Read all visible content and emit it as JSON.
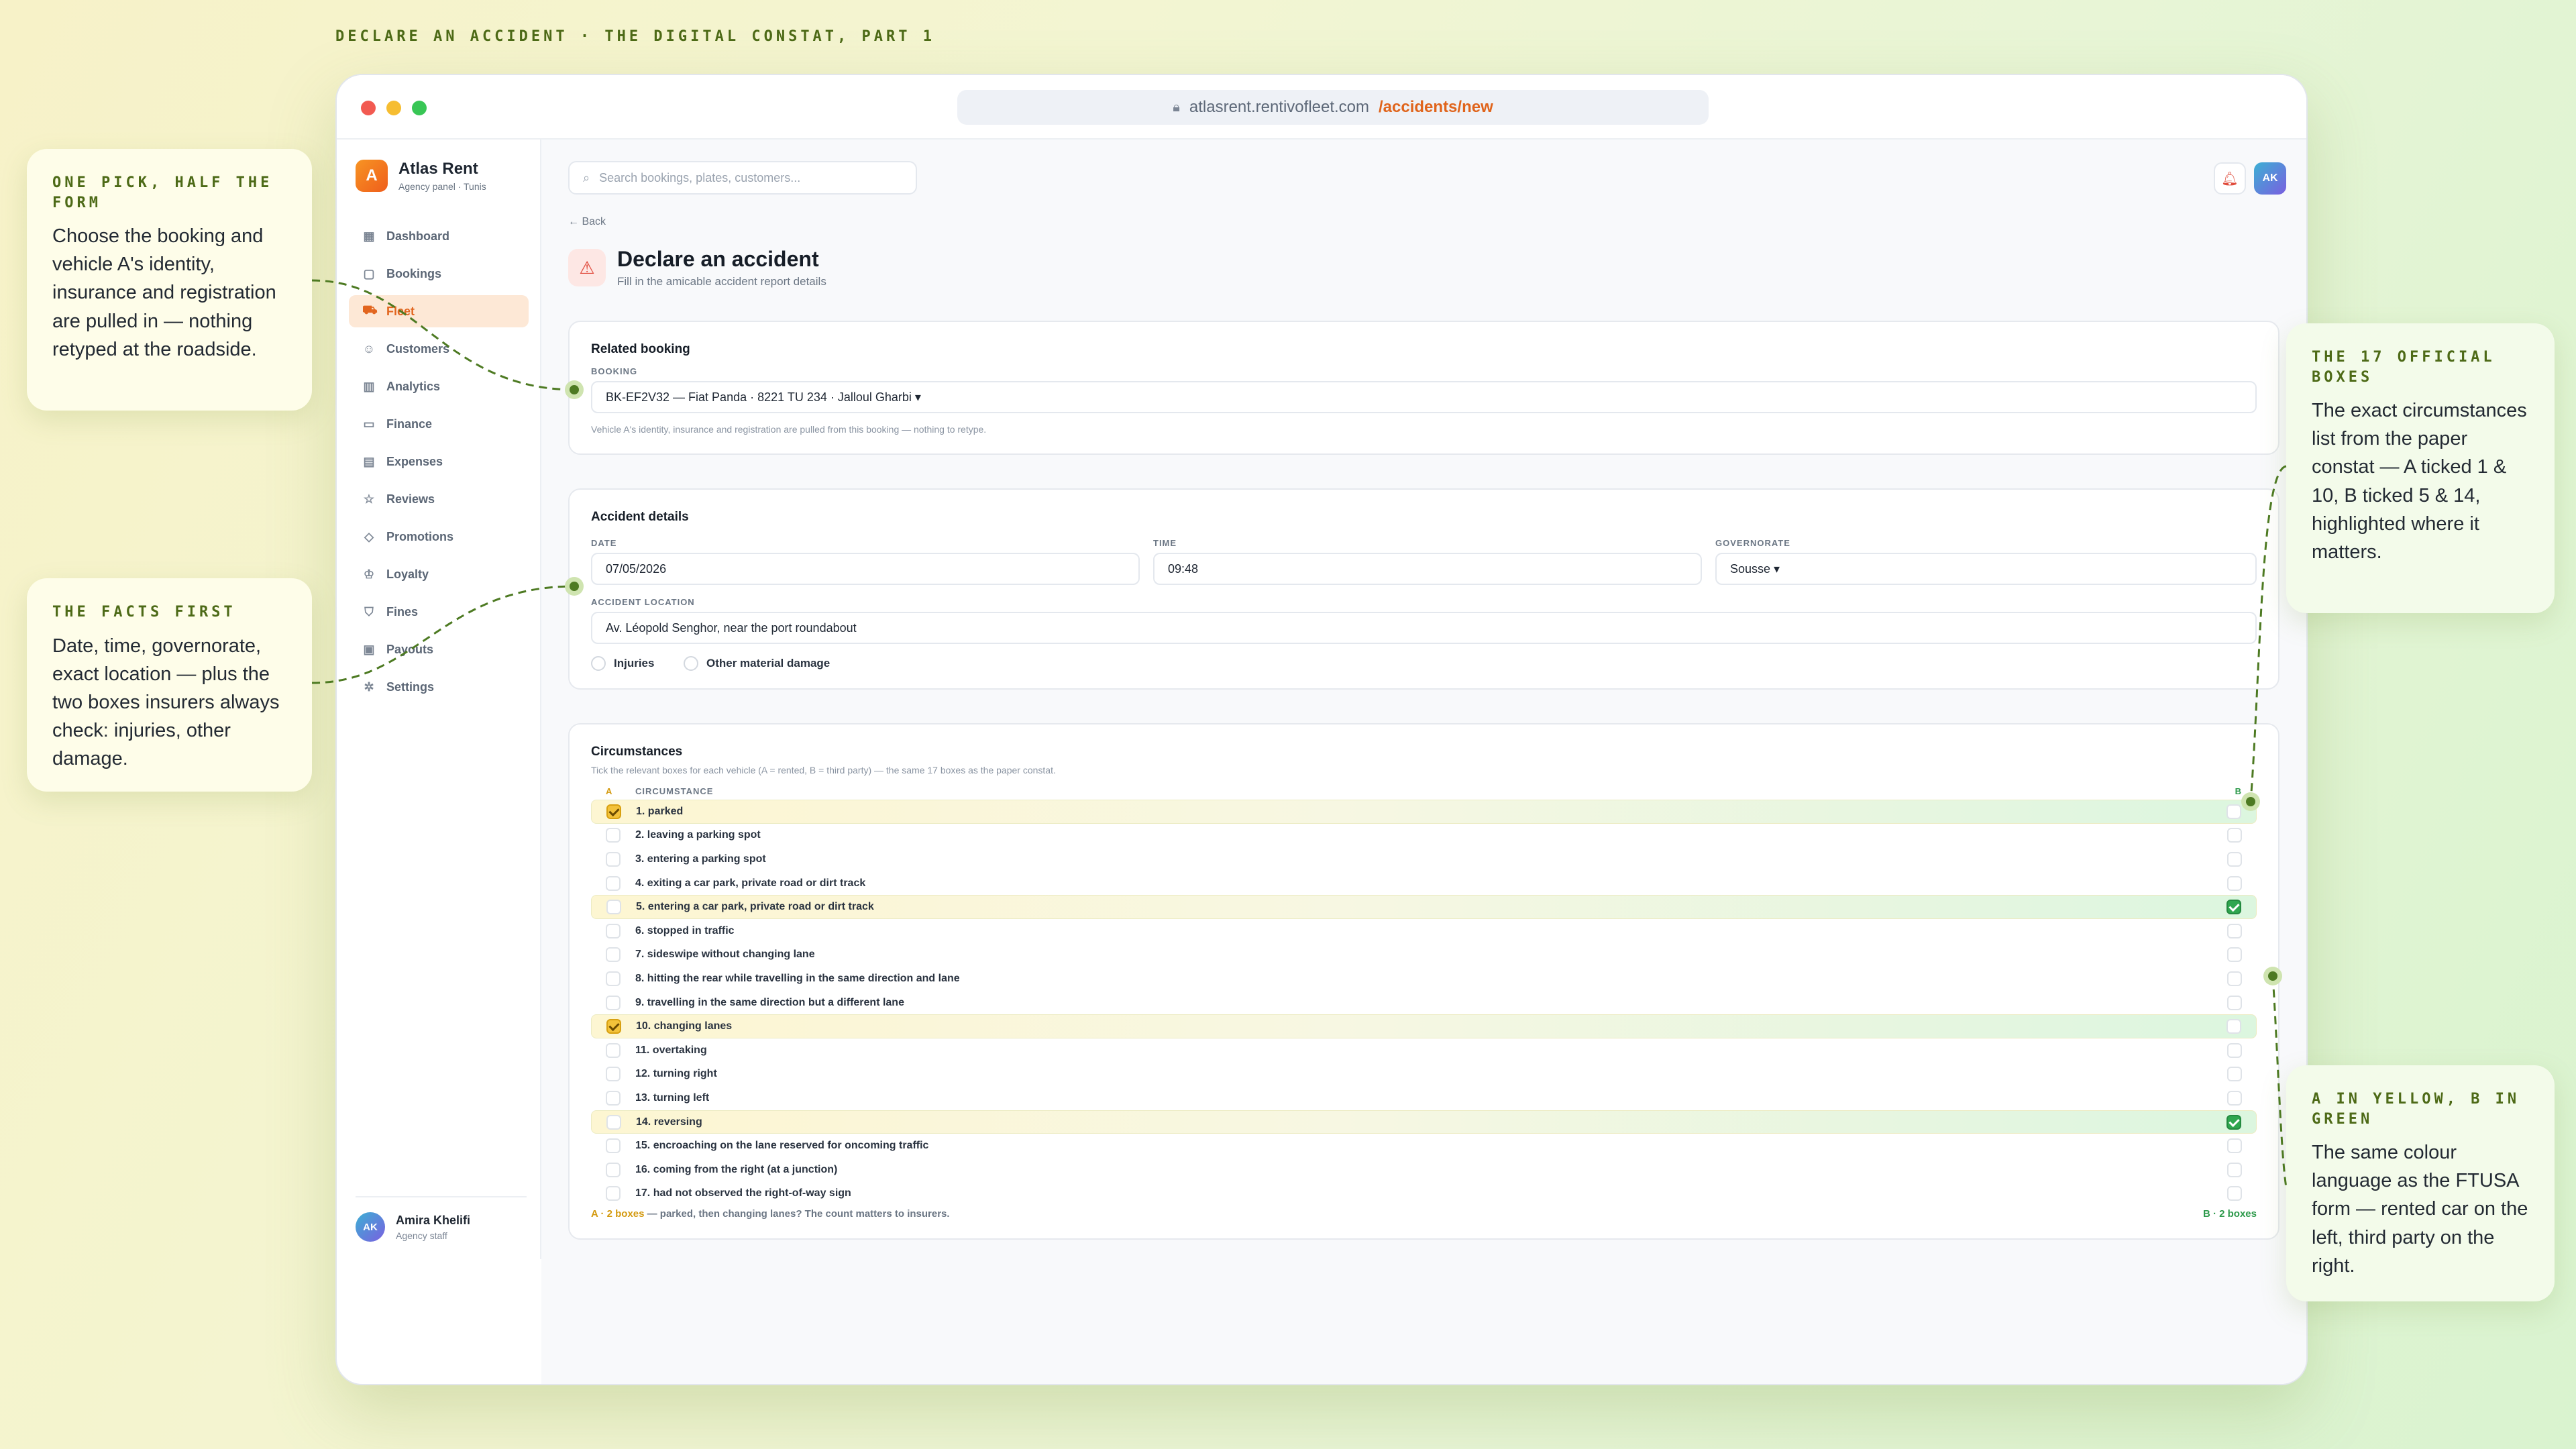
{
  "heading": "DECLARE AN ACCIDENT · THE DIGITAL CONSTAT, PART 1",
  "browser": {
    "url_host": "atlasrent.rentivofleet.com",
    "url_path": "/accidents/new"
  },
  "brand": {
    "logo_letter": "A",
    "name": "Atlas Rent",
    "subtitle": "Agency panel · Tunis"
  },
  "nav": [
    {
      "label": "Dashboard",
      "icon": "grid-icon",
      "glyph": "▦"
    },
    {
      "label": "Bookings",
      "icon": "calendar-icon",
      "glyph": "▢"
    },
    {
      "label": "Fleet",
      "icon": "car-icon",
      "glyph": "⛟",
      "active": true
    },
    {
      "label": "Customers",
      "icon": "users-icon",
      "glyph": "☺"
    },
    {
      "label": "Analytics",
      "icon": "chart-icon",
      "glyph": "▥"
    },
    {
      "label": "Finance",
      "icon": "wallet-icon",
      "glyph": "▭"
    },
    {
      "label": "Expenses",
      "icon": "receipt-icon",
      "glyph": "▤"
    },
    {
      "label": "Reviews",
      "icon": "star-icon",
      "glyph": "☆"
    },
    {
      "label": "Promotions",
      "icon": "tag-icon",
      "glyph": "◇"
    },
    {
      "label": "Loyalty",
      "icon": "crown-icon",
      "glyph": "♔"
    },
    {
      "label": "Fines",
      "icon": "shield-icon",
      "glyph": "⛉"
    },
    {
      "label": "Payouts",
      "icon": "payout-icon",
      "glyph": "▣"
    },
    {
      "label": "Settings",
      "icon": "gear-icon",
      "glyph": "✲"
    }
  ],
  "user": {
    "initials": "AK",
    "name": "Amira Khelifi",
    "role": "Agency staff"
  },
  "search": {
    "placeholder": "Search bookings, plates, customers..."
  },
  "header": {
    "avatar": "AK"
  },
  "back_label": "← Back",
  "page": {
    "title": "Declare an accident",
    "subtitle": "Fill in the amicable accident report details"
  },
  "related_booking": {
    "title": "Related booking",
    "booking_label": "BOOKING",
    "booking_value": "BK-EF2V32 — Fiat Panda · 8221 TU 234 · Jalloul Gharbi ▾",
    "hint": "Vehicle A's identity, insurance and registration are pulled from this booking — nothing to retype."
  },
  "accident_details": {
    "title": "Accident details",
    "date_label": "DATE",
    "date_value": "07/05/2026",
    "time_label": "TIME",
    "time_value": "09:48",
    "gov_label": "GOVERNORATE",
    "gov_value": "Sousse ▾",
    "location_label": "ACCIDENT LOCATION",
    "location_value": "Av. Léopold Senghor, near the port roundabout",
    "injuries_label": "Injuries",
    "damage_label": "Other material damage"
  },
  "circumstances": {
    "title": "Circumstances",
    "hint": "Tick the relevant boxes for each vehicle (A = rented, B = third party) — the same 17 boxes as the paper constat.",
    "col_a": "A",
    "col_name": "CIRCUMSTANCE",
    "col_b": "B",
    "items": [
      {
        "label": "1. parked",
        "a": true,
        "b": false
      },
      {
        "label": "2. leaving a parking spot",
        "a": false,
        "b": false
      },
      {
        "label": "3. entering a parking spot",
        "a": false,
        "b": false
      },
      {
        "label": "4. exiting a car park, private road or dirt track",
        "a": false,
        "b": false
      },
      {
        "label": "5. entering a car park, private road or dirt track",
        "a": false,
        "b": true
      },
      {
        "label": "6. stopped in traffic",
        "a": false,
        "b": false
      },
      {
        "label": "7. sideswipe without changing lane",
        "a": false,
        "b": false
      },
      {
        "label": "8. hitting the rear while travelling in the same direction and lane",
        "a": false,
        "b": false
      },
      {
        "label": "9. travelling in the same direction but a different lane",
        "a": false,
        "b": false
      },
      {
        "label": "10. changing lanes",
        "a": true,
        "b": false
      },
      {
        "label": "11. overtaking",
        "a": false,
        "b": false
      },
      {
        "label": "12. turning right",
        "a": false,
        "b": false
      },
      {
        "label": "13. turning left",
        "a": false,
        "b": false
      },
      {
        "label": "14. reversing",
        "a": false,
        "b": true
      },
      {
        "label": "15. encroaching on the lane reserved for oncoming traffic",
        "a": false,
        "b": false
      },
      {
        "label": "16. coming from the right (at a junction)",
        "a": false,
        "b": false
      },
      {
        "label": "17. had not observed the right-of-way sign",
        "a": false,
        "b": false
      }
    ],
    "foot_a": "A · 2 boxes",
    "foot_text": " — parked, then changing lanes? The count matters to insurers.",
    "foot_b": "B · 2 boxes"
  },
  "callouts": {
    "one_pick": {
      "title": "ONE PICK, HALF THE FORM",
      "body": "Choose the booking and vehicle A's identity, insurance and registration are pulled in — nothing retyped at the roadside."
    },
    "facts": {
      "title": "THE FACTS FIRST",
      "body": "Date, time, governorate, exact location — plus the two boxes insurers always check: injuries, other damage."
    },
    "boxes": {
      "title": "THE 17 OFFICIAL BOXES",
      "body": "The exact circumstances list from the paper constat — A ticked 1 & 10, B ticked 5 & 14, highlighted where it matters."
    },
    "colours": {
      "title": "A IN YELLOW, B IN GREEN",
      "body": "The same colour language as the FTUSA form — rented car on the left, third party on the right."
    }
  },
  "colors": {
    "accent": "#e2651e",
    "vehicle_a": "#f3c23a",
    "vehicle_b": "#2fa64f",
    "connector": "#4d7a22"
  }
}
